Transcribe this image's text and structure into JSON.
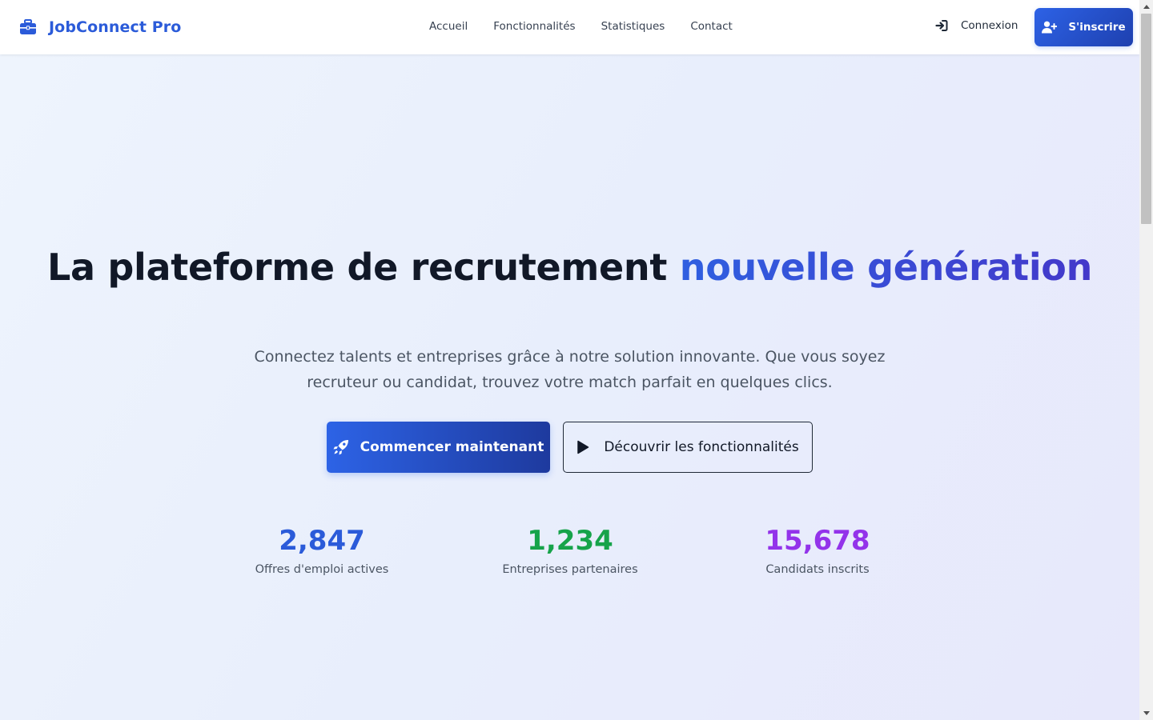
{
  "header": {
    "brand": "JobConnect Pro",
    "nav": [
      "Accueil",
      "Fonctionnalités",
      "Statistiques",
      "Contact"
    ],
    "login_label": "Connexion",
    "signup_label": "S'inscrire"
  },
  "hero": {
    "headline_main": "La plateforme de recrutement ",
    "headline_accent": "nouvelle génération",
    "subtitle": "Connectez talents et entreprises grâce à notre solution innovante. Que vous soyez recruteur ou candidat, trouvez votre match parfait en quelques clics.",
    "cta_primary": "Commencer maintenant",
    "cta_secondary": "Découvrir les fonctionnalités"
  },
  "stats": [
    {
      "value": "2,847",
      "label": "Offres d'emploi actives",
      "color": "#2b5bd9"
    },
    {
      "value": "1,234",
      "label": "Entreprises partenaires",
      "color": "#16a34a"
    },
    {
      "value": "15,678",
      "label": "Candidats inscrits",
      "color": "#9333ea"
    }
  ],
  "icons": {
    "brand": "briefcase-icon",
    "login": "sign-in-icon",
    "signup": "user-plus-icon",
    "cta_primary": "rocket-icon",
    "cta_secondary": "play-icon"
  },
  "colors": {
    "accent": "#2b5bd9",
    "accent_dark": "#1e40af"
  }
}
